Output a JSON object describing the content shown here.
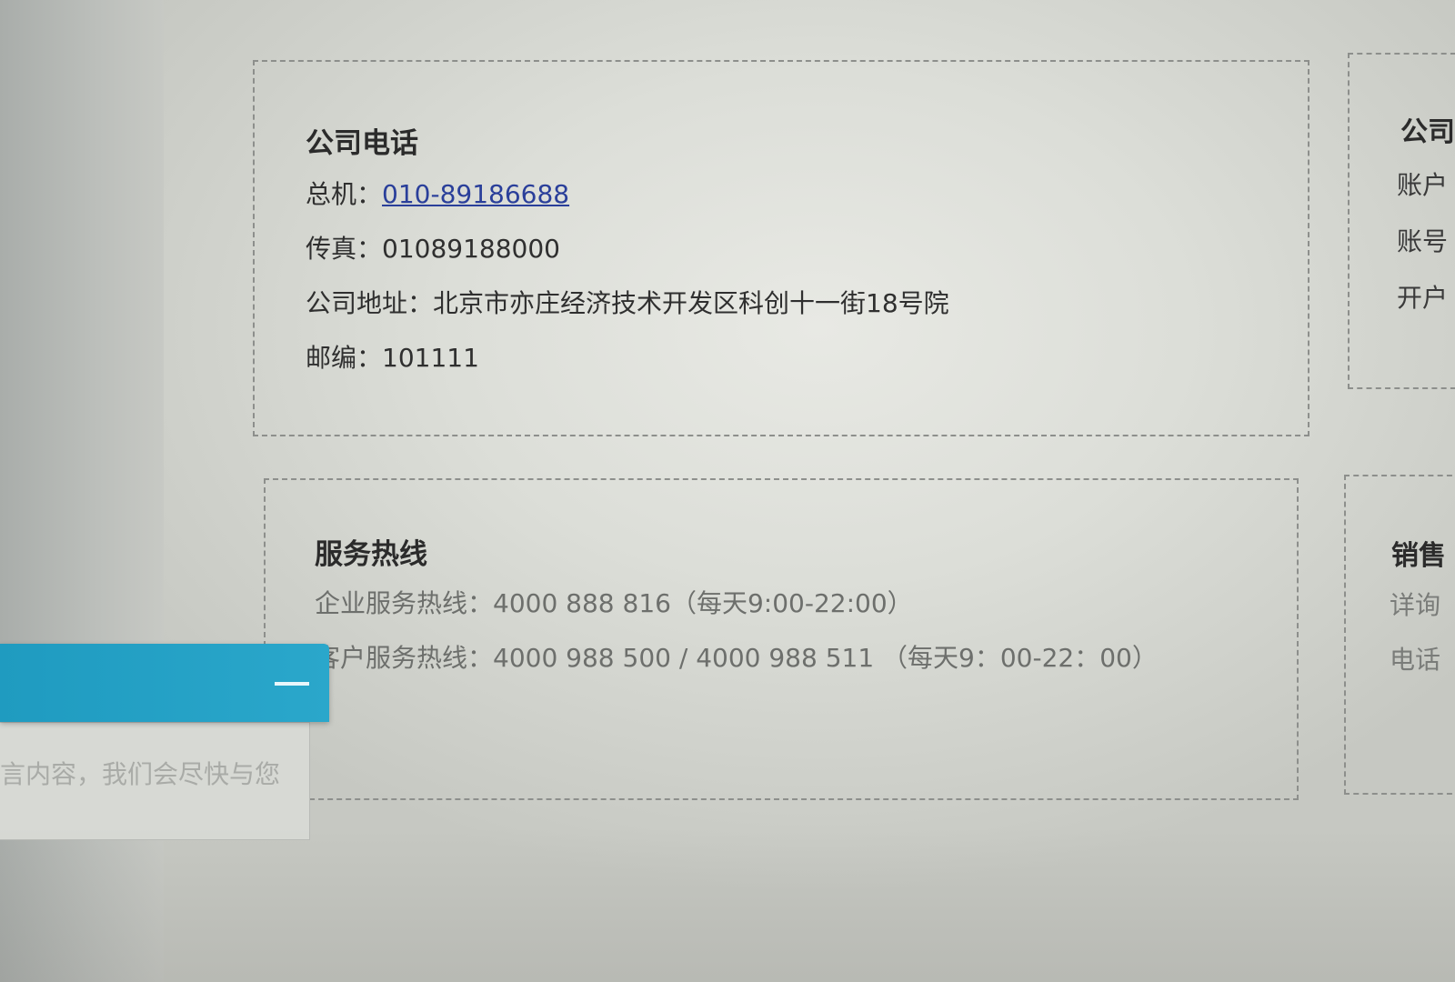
{
  "company_phone": {
    "title": "公司电话",
    "switchboard_label": "总机：",
    "switchboard_value": "010-89186688",
    "fax_label": "传真：",
    "fax_value": "01089188000",
    "address_label": "公司地址：",
    "address_value": "北京市亦庄经济技术开发区科创十一街18号院",
    "postcode_label": "邮编：",
    "postcode_value": "101111"
  },
  "service_hotline": {
    "title": "服务热线",
    "enterprise_label": "企业服务热线：",
    "enterprise_value": "4000 888 816（每天9:00-22:00）",
    "customer_label": "客户服务热线：",
    "customer_value": "4000 988 500 / 4000 988 511 （每天9：00-22：00）"
  },
  "right_column": {
    "top_title_partial": "公司",
    "top_line1_partial": "账户",
    "top_line2_partial": "账号",
    "top_line3_partial": "开户",
    "bottom_title_partial": "销售",
    "bottom_line1_partial": "详询",
    "bottom_line2_partial": "电话"
  },
  "chat_widget": {
    "placeholder_partial": "言内容，我们会尽快与您"
  }
}
